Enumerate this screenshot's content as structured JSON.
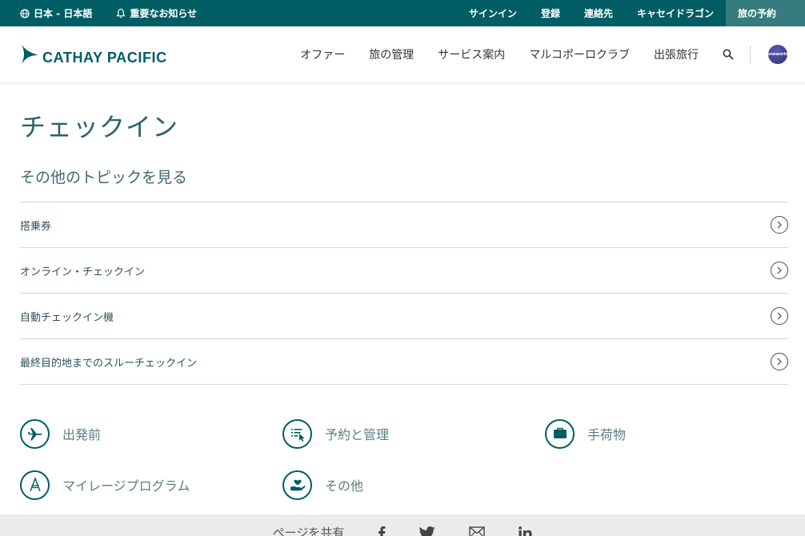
{
  "topbar": {
    "language": "日本 - 日本語",
    "notice": "重要なお知らせ",
    "links": [
      "サインイン",
      "登録",
      "連絡先",
      "キャセイドラゴン"
    ],
    "book": "旅の予約"
  },
  "header": {
    "logo_text": "CATHAY PACIFIC",
    "nav": [
      "オファー",
      "旅の管理",
      "サービス案内",
      "マルコポーロクラブ",
      "出張旅行"
    ],
    "oneworld_text": "oneworld"
  },
  "main": {
    "title": "チェックイン",
    "topics_heading": "その他のトピックを見る",
    "topics": [
      "搭乗券",
      "オンライン・チェックイン",
      "自動チェックイン機",
      "最終目的地までのスルーチェックイン"
    ],
    "categories": [
      {
        "label": "出発前",
        "icon": "airplane-icon"
      },
      {
        "label": "予約と管理",
        "icon": "booking-list-icon"
      },
      {
        "label": "手荷物",
        "icon": "baggage-icon"
      },
      {
        "label": "マイレージプログラム",
        "icon": "mileage-icon"
      },
      {
        "label": "その他",
        "icon": "heart-hand-icon"
      }
    ]
  },
  "share": {
    "label": "ページを共有"
  },
  "colors": {
    "brand": "#005d63",
    "book_button": "#367c7e",
    "share_bg": "#ebebeb"
  }
}
